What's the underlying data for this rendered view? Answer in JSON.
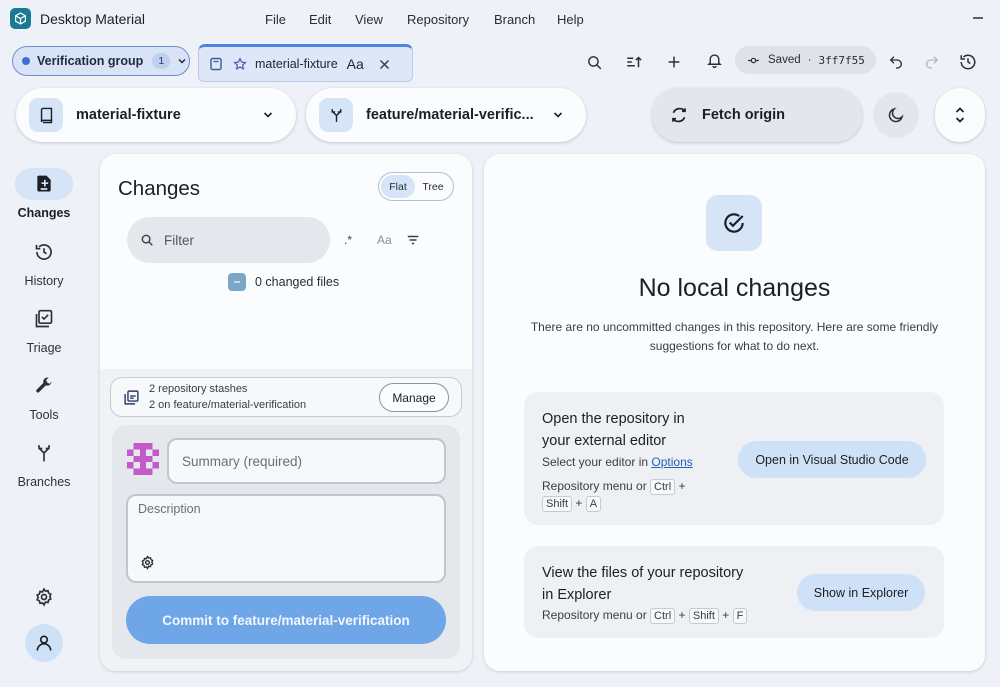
{
  "app": {
    "title": "Desktop Material",
    "logo_icon": "cube-icon"
  },
  "menu": [
    "File",
    "Edit",
    "View",
    "Repository",
    "Branch",
    "Help"
  ],
  "toolbar": {
    "group_label": "Verification group",
    "group_count": "1",
    "repo_tab_label": "material-fixture",
    "repo_tab_aa": "Aa",
    "saved_label": "Saved",
    "saved_separator": "·",
    "saved_hash": "3ff7f55"
  },
  "repo_selector": {
    "name": "material-fixture"
  },
  "branch_selector": {
    "name": "feature/material-verific..."
  },
  "fetch": {
    "label": "Fetch origin"
  },
  "nav": {
    "changes": "Changes",
    "history": "History",
    "triage": "Triage",
    "tools": "Tools",
    "branches": "Branches"
  },
  "changes_panel": {
    "title": "Changes",
    "view_flat": "Flat",
    "view_tree": "Tree",
    "filter_placeholder": "Filter",
    "regex_toggle": ".*",
    "case_toggle": "Aa",
    "changed_files": "0 changed files",
    "stash_line1": "2 repository stashes",
    "stash_line2": "2 on feature/material-verification",
    "manage_label": "Manage",
    "summary_placeholder": "Summary (required)",
    "description_placeholder": "Description",
    "commit_label": "Commit to feature/material-verification"
  },
  "empty_state": {
    "title": "No local changes",
    "description": "There are no uncommitted changes in this repository. Here are some friendly suggestions for what to do next.",
    "card1": {
      "title_line1": "Open the repository in",
      "title_line2": "your external editor",
      "sub_prefix": "Select your editor in ",
      "sub_link": "Options",
      "shortcut_prefix": "Repository menu or ",
      "key_ctrl": "Ctrl",
      "plus": "+",
      "key_shift": "Shift",
      "key_a": "A",
      "button": "Open in Visual Studio Code"
    },
    "card2": {
      "title_line1": "View the files of your repository",
      "title_line2": "in Explorer",
      "shortcut_prefix": "Repository menu or ",
      "key_ctrl": "Ctrl",
      "plus": "+",
      "key_shift": "Shift",
      "key_f": "F",
      "button": "Show in Explorer"
    }
  },
  "colors": {
    "accent": "#3b6fd4",
    "commit_button": "#6fa6e8",
    "icon_box": "#d6e4f7",
    "background": "#eef1f7"
  }
}
